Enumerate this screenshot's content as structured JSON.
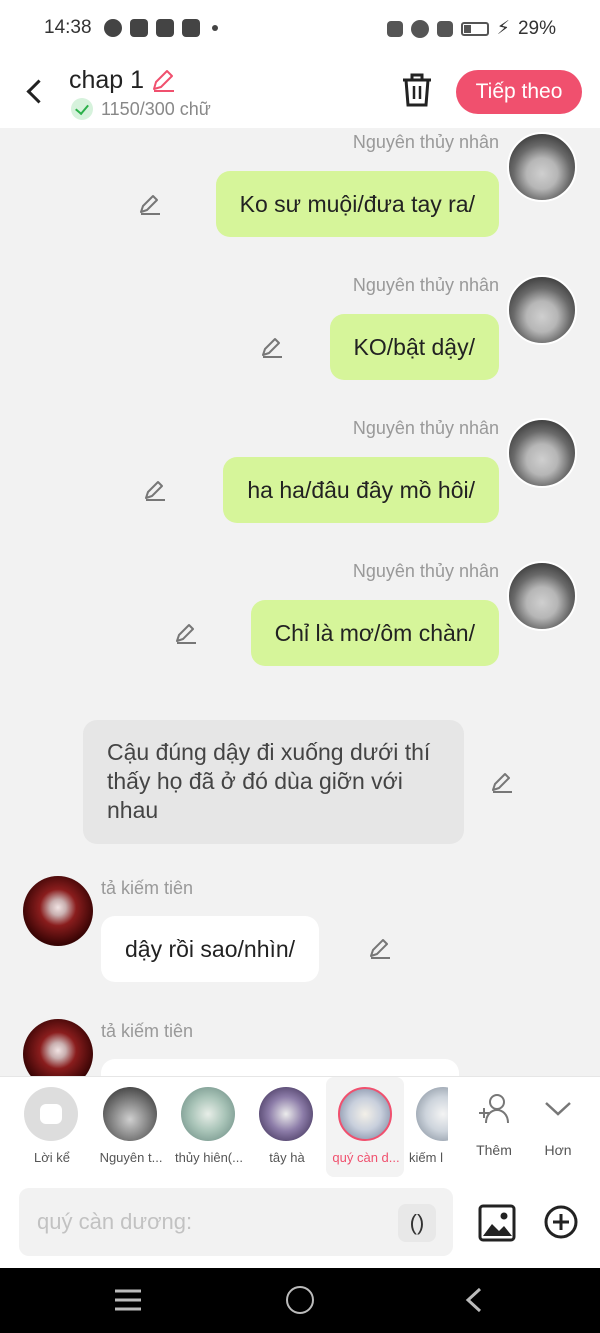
{
  "status_bar": {
    "time": "14:38",
    "battery": "29%"
  },
  "header": {
    "title": "chap 1",
    "word_count": "1150/300 chữ",
    "next_label": "Tiếp theo"
  },
  "messages": [
    {
      "name": "Nguyên thủy nhân",
      "text": "Ko sư muội/đưa tay ra/"
    },
    {
      "name": "Nguyên thủy nhân",
      "text": "KO/bật dậy/"
    },
    {
      "name": "Nguyên thủy nhân",
      "text": "ha ha/đâu đây mồ hôi/"
    },
    {
      "name": "Nguyên thủy nhân",
      "text": "Chỉ là mơ/ôm chàn/"
    }
  ],
  "narration": "Cậu đúng dậy đi xuống dưới thí thấy họ đã ở đó dùa giỡn với nhau",
  "left_messages": [
    {
      "name": "tả kiếm tiên",
      "text": "dậy rồi sao/nhìn/"
    },
    {
      "name": "tả kiếm tiên",
      "text": ""
    }
  ],
  "characters": [
    {
      "label": "Lời kể",
      "color": "#dddddd"
    },
    {
      "label": "Nguyên t...",
      "color": "#5a5a5a"
    },
    {
      "label": "thủy hiên(...",
      "color": "#8fb3a6"
    },
    {
      "label": "tây hà",
      "color": "#5a4a7a"
    },
    {
      "label": "quý càn d...",
      "color": "#b6c4d8"
    },
    {
      "label": "kiếm l",
      "color": "#c9d2dc"
    }
  ],
  "tools": {
    "add_label": "Thêm",
    "more_label": "Hơn"
  },
  "composer": {
    "placeholder": "quý càn dương:",
    "paren": "()"
  },
  "colors": {
    "accent": "#f0506e",
    "bubble_green": "#d6f59a",
    "narration_bg": "#e6e6e6"
  }
}
